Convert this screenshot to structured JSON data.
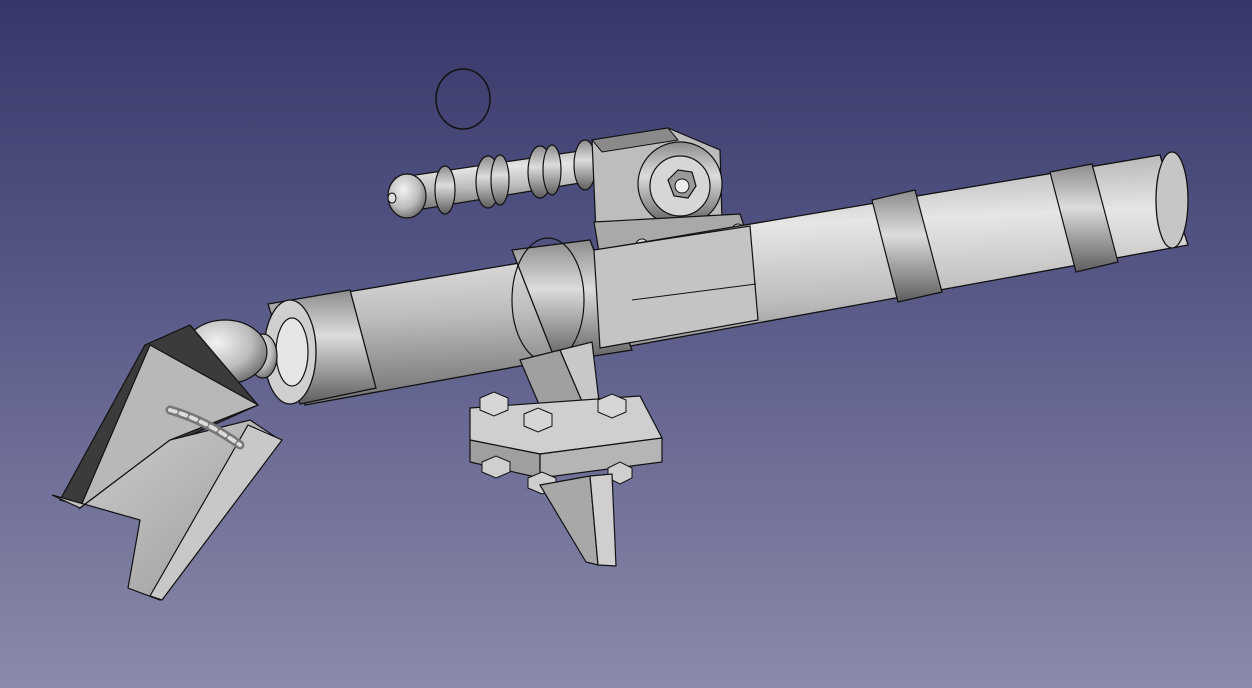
{
  "viewport": {
    "background_top": "#363669",
    "background_bottom": "#8a8aaa",
    "part_color": "#bdbdbd",
    "edge_color": "#111111"
  }
}
